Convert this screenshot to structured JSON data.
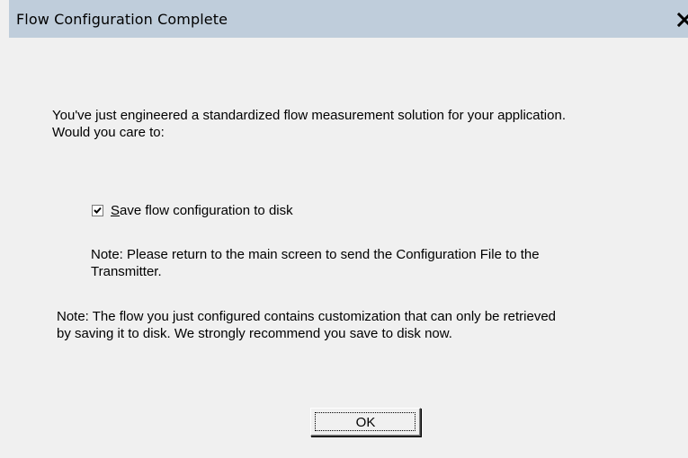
{
  "window": {
    "title": "Flow Configuration Complete",
    "close_icon": "close-icon"
  },
  "content": {
    "intro": "You've just engineered a standardized flow measurement solution for your application.\nWould you care to:",
    "checkbox": {
      "checked": true,
      "mnemonic": "S",
      "label_rest": "ave flow configuration to disk"
    },
    "note1": "Note: Please return to the main screen to send the Configuration File to the\nTransmitter.",
    "note2": "Note:  The flow you just configured contains customization that can only be retrieved\nby saving it to disk.  We strongly recommend you save to disk now."
  },
  "buttons": {
    "ok_label": "OK"
  }
}
